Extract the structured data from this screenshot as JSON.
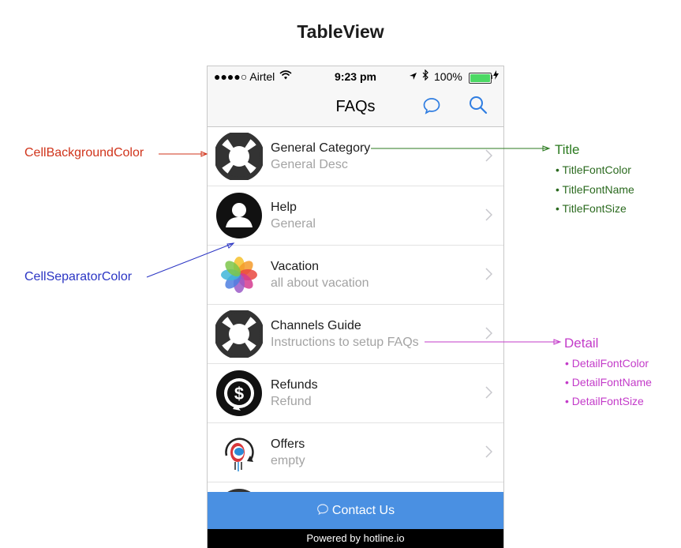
{
  "heading": "TableView",
  "status_bar": {
    "carrier": "●●●●○ Airtel",
    "time": "9:23 pm",
    "battery": "100%"
  },
  "nav": {
    "title": "FAQs"
  },
  "rows": [
    {
      "title": "General Category",
      "detail": "General Desc",
      "icon": "lifebuoy-icon"
    },
    {
      "title": "Help",
      "detail": "General",
      "icon": "person-icon"
    },
    {
      "title": "Vacation",
      "detail": "all about vacation",
      "icon": "photos-flower-icon"
    },
    {
      "title": "Channels Guide",
      "detail": "Instructions to setup FAQs",
      "icon": "lifebuoy-icon"
    },
    {
      "title": "Refunds",
      "detail": "Refund",
      "icon": "dollar-refund-icon"
    },
    {
      "title": "Offers",
      "detail": "empty",
      "icon": "offers-logo-icon"
    }
  ],
  "contact_button": "Contact Us",
  "powered_by": "Powered by hotline.io",
  "annotations": {
    "cell_background": "CellBackgroundColor",
    "cell_separator": "CellSeparatorColor",
    "title": {
      "label": "Title",
      "items": [
        "TitleFontColor",
        "TitleFontName",
        "TitleFontSize"
      ]
    },
    "detail": {
      "label": "Detail",
      "items": [
        "DetailFontColor",
        "DetailFontName",
        "DetailFontSize"
      ]
    }
  },
  "colors": {
    "accent": "#4a90e2",
    "red_annotation": "#d0341b",
    "blue_annotation": "#2b35c4",
    "green_annotation": "#2b7a1f",
    "pink_annotation": "#c33bc9"
  }
}
